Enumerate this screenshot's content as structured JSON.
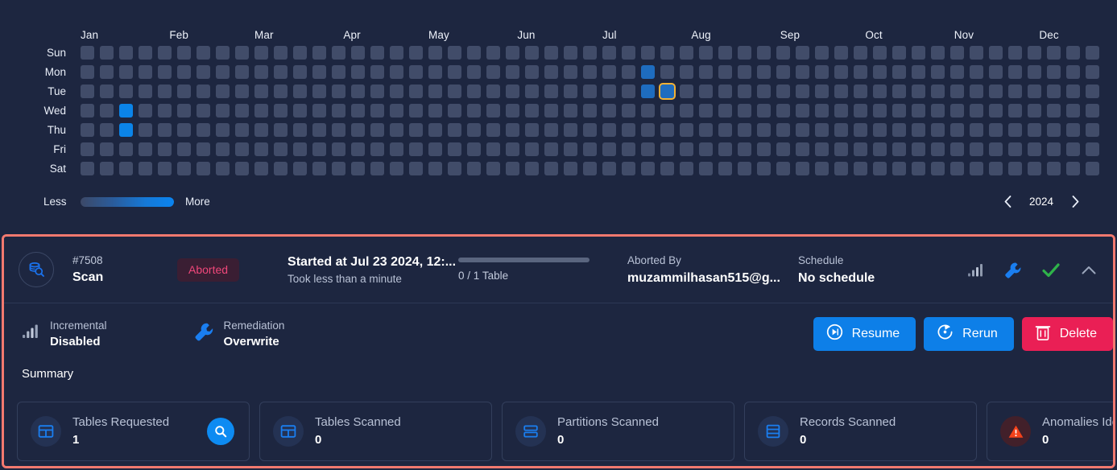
{
  "heatmap": {
    "months": [
      "Jan",
      "Feb",
      "Mar",
      "Apr",
      "May",
      "Jun",
      "Jul",
      "Aug",
      "Sep",
      "Oct",
      "Nov",
      "Dec"
    ],
    "days": [
      "Sun",
      "Mon",
      "Tue",
      "Wed",
      "Thu",
      "Fri",
      "Sat"
    ],
    "legend_less": "Less",
    "legend_more": "More",
    "year": "2024",
    "prev_year_icon": "chevron-left-icon",
    "next_year_icon": "chevron-right-icon",
    "colors": {
      "empty": "#414c69",
      "level1": "#1e6cbf",
      "level2": "#0b84e8",
      "selected_outline": "#f2b135"
    },
    "weeks": 53,
    "active_cells": [
      {
        "week": 2,
        "day": 3,
        "level": 2
      },
      {
        "week": 2,
        "day": 4,
        "level": 2
      },
      {
        "week": 29,
        "day": 1,
        "level": 1
      },
      {
        "week": 29,
        "day": 2,
        "level": 1
      },
      {
        "week": 30,
        "day": 2,
        "level": 1,
        "selected": true
      }
    ]
  },
  "job": {
    "icon": "database-search-icon",
    "id": "#7508",
    "type": "Scan",
    "status": "Aborted",
    "started_at": "Started at Jul 23 2024, 12:...",
    "duration": "Took less than a minute",
    "progress_text": "0 / 1 Table",
    "progress_percent": 0,
    "aborted_by_label": "Aborted By",
    "aborted_by_value": "muzammilhasan515@g...",
    "schedule_label": "Schedule",
    "schedule_value": "No schedule",
    "header_icons": [
      "bar-chart-icon",
      "wrench-icon",
      "check-icon",
      "chevron-up-icon"
    ],
    "meta": [
      {
        "icon": "bar-chart-icon",
        "label": "Incremental",
        "value": "Disabled"
      },
      {
        "icon": "wrench-icon",
        "label": "Remediation",
        "value": "Overwrite"
      }
    ],
    "actions": [
      {
        "label": "Resume",
        "icon": "play-circle-icon",
        "style": "blue"
      },
      {
        "label": "Rerun",
        "icon": "rerun-circle-icon",
        "style": "blue"
      },
      {
        "label": "Delete",
        "icon": "trash-icon",
        "style": "red"
      }
    ],
    "summary_title": "Summary",
    "summary_cards": [
      {
        "icon": "table-grid-icon",
        "label": "Tables Requested",
        "value": "1",
        "action": "search-icon"
      },
      {
        "icon": "table-grid-icon",
        "label": "Tables Scanned",
        "value": "0",
        "action": null
      },
      {
        "icon": "partitions-icon",
        "label": "Partitions Scanned",
        "value": "0",
        "action": null
      },
      {
        "icon": "records-icon",
        "label": "Records Scanned",
        "value": "0",
        "action": null
      },
      {
        "icon": "warning-triangle-icon",
        "label": "Anomalies Identified",
        "value": "0",
        "action": "arrow-up-right-icon"
      }
    ]
  },
  "theme": {
    "background": "#1d2640",
    "accent_blue": "#0d7fe8",
    "danger_red": "#ea1f55",
    "status_text": "#f0477a",
    "selection_outline": "#f2796f"
  }
}
